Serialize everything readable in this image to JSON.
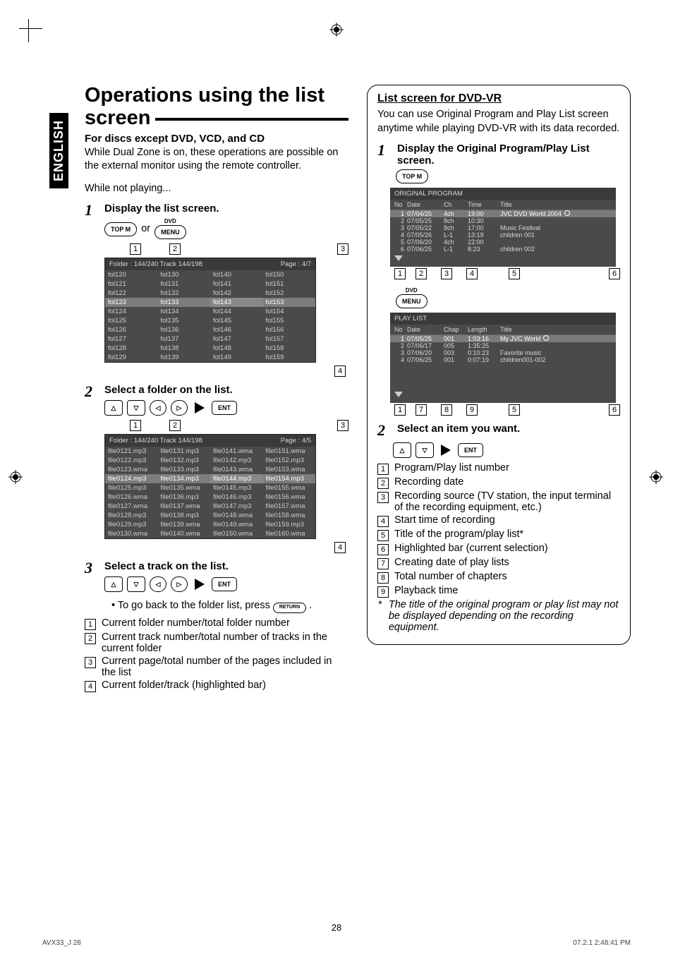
{
  "lang_tab": "ENGLISH",
  "left": {
    "title": "Operations using the list screen",
    "sub1": "For discs except DVD, VCD, and CD",
    "intro1": "While Dual Zone is on, these operations are possible on the external monitor using the remote controller.",
    "intro2": "While not playing...",
    "step1_title": "Display the list screen.",
    "or": "or",
    "btn_topm": "TOP M",
    "btn_dvd": "DVD",
    "btn_menu": "MENU",
    "screen1": {
      "header_left": "Folder : 144/240  Track 144/198",
      "header_right": "Page : 4/7",
      "cols": [
        [
          "fol120",
          "fol130",
          "fol140",
          "fol150"
        ],
        [
          "fol121",
          "fol131",
          "fol141",
          "fol151"
        ],
        [
          "fol122",
          "fol132",
          "fol142",
          "fol152"
        ],
        [
          "fol123",
          "fol133",
          "fol143",
          "fol153"
        ],
        [
          "fol124",
          "fol134",
          "fol144",
          "fol154"
        ],
        [
          "fol125",
          "fol135",
          "fol145",
          "fol155"
        ],
        [
          "fol126",
          "fol136",
          "fol146",
          "fol156"
        ],
        [
          "fol127",
          "fol137",
          "fol147",
          "fol157"
        ],
        [
          "fol128",
          "fol138",
          "fol148",
          "fol158"
        ],
        [
          "fol129",
          "fol139",
          "fol149",
          "fol159"
        ]
      ],
      "callouts": [
        "1",
        "2",
        "3",
        "4"
      ]
    },
    "step2_title": "Select a folder on the list.",
    "btn_ent": "ENT",
    "screen2": {
      "header_left": "Folder : 144/240  Track 144/198",
      "header_right": "Page : 4/5",
      "cols": [
        [
          "file0121.mp3",
          "file0131.mp3",
          "file0141.wma",
          "file0151.wma"
        ],
        [
          "file0122.mp3",
          "file0132.mp3",
          "file0142.mp3",
          "file0152.mp3"
        ],
        [
          "file0123.wma",
          "file0133.mp3",
          "file0143.wma",
          "file0153.wma"
        ],
        [
          "file0124.mp3",
          "file0134.mp3",
          "file0144.mp3",
          "file0154.mp3"
        ],
        [
          "file0125.mp3",
          "file0135.wma",
          "file0145.mp3",
          "file0155.wma"
        ],
        [
          "file0126.wma",
          "file0136.mp3",
          "file0146.mp3",
          "file0156.wma"
        ],
        [
          "file0127.wma",
          "file0137.wma",
          "file0147.mp3",
          "file0157.wma"
        ],
        [
          "file0128.mp3",
          "file0138.mp3",
          "file0148.wma",
          "file0158.wma"
        ],
        [
          "file0129.mp3",
          "file0139.wma",
          "file0149.wma",
          "file0159.mp3"
        ],
        [
          "file0130.wma",
          "file0140.wma",
          "file0150.wma",
          "file0160.wma"
        ]
      ],
      "callouts": [
        "1",
        "2",
        "3",
        "4"
      ]
    },
    "step3_title": "Select a track on the list.",
    "bullet_return": "To go back to the folder list, press",
    "btn_return": "RETURN",
    "legend": {
      "1": "Current folder number/total folder number",
      "2": "Current track number/total number of tracks in the current folder",
      "3": "Current page/total number of the pages included in the list",
      "4": "Current folder/track (highlighted bar)"
    }
  },
  "right": {
    "panel_title": "List screen for DVD-VR",
    "panel_intro": "You can use Original Program and Play List screen anytime while playing DVD-VR with its data recorded.",
    "step1_title": "Display the Original Program/Play List screen.",
    "btn_topm": "TOP M",
    "orig_hdr": "ORIGINAL PROGRAM",
    "orig_cols": [
      "No",
      "Date",
      "Ch",
      "Time",
      "Title"
    ],
    "orig_rows": [
      [
        "1",
        "07/04/25",
        "4ch",
        "19:00",
        "JVC DVD World 2004"
      ],
      [
        "2",
        "07/05/25",
        "8ch",
        "10:30",
        ""
      ],
      [
        "3",
        "07/05/22",
        "8ch",
        "17:00",
        "Music Festival"
      ],
      [
        "4",
        "07/05/26",
        "L-1",
        "13:19",
        "children 001"
      ],
      [
        "5",
        "07/06/20",
        "4ch",
        "22:00",
        ""
      ],
      [
        "6",
        "07/06/25",
        "L-1",
        "8:23",
        "children 002"
      ]
    ],
    "orig_callouts": [
      "1",
      "2",
      "3",
      "4",
      "5",
      "6"
    ],
    "btn_dvd": "DVD",
    "btn_menu": "MENU",
    "pl_hdr": "PLAY LIST",
    "pl_cols": [
      "No",
      "Date",
      "Chap",
      "Length",
      "Title"
    ],
    "pl_rows": [
      [
        "1",
        "07/05/25",
        "001",
        "1:03:16",
        "My JVC World"
      ],
      [
        "2",
        "07/06/17",
        "005",
        "1:35:25",
        ""
      ],
      [
        "3",
        "07/06/20",
        "003",
        "0:10:23",
        "Favorite music"
      ],
      [
        "4",
        "07/06/25",
        "001",
        "0:07:19",
        "children001-002"
      ]
    ],
    "pl_callouts": [
      "1",
      "7",
      "8",
      "9",
      "5",
      "6"
    ],
    "step2_title": "Select an item you want.",
    "btn_ent": "ENT",
    "legend": {
      "1": "Program/Play list number",
      "2": "Recording date",
      "3": "Recording source (TV station, the input terminal of the recording equipment, etc.)",
      "4": "Start time of recording",
      "5": "Title of the program/play list*",
      "6": "Highlighted bar (current selection)",
      "7": "Creating date of play lists",
      "8": "Total number of chapters",
      "9": "Playback time"
    },
    "star": "*",
    "note": "The title of the original program or play list may not be displayed depending on the recording equipment."
  },
  "page_number": "28",
  "footer_left": "AVX33_J   28",
  "footer_right": "07.2.1   2:48:41 PM"
}
